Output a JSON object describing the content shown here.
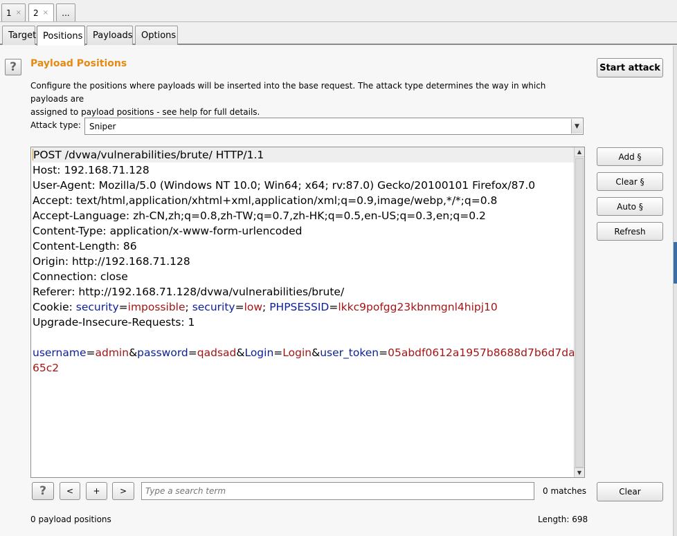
{
  "top_tabs": [
    {
      "label": "1",
      "close": "×"
    },
    {
      "label": "2",
      "close": "×"
    },
    {
      "label": "..."
    }
  ],
  "sub_tabs": [
    "Target",
    "Positions",
    "Payloads",
    "Options"
  ],
  "active_sub_tab": "Positions",
  "help_glyph": "?",
  "section": {
    "title": "Payload Positions",
    "description_1": "Configure the positions where payloads will be inserted into the base request. The attack type determines the way in which payloads are",
    "description_2": "assigned to payload positions - see help for full details."
  },
  "start_attack_label": "Start attack",
  "attack_type": {
    "label": "Attack type:",
    "value": "Sniper"
  },
  "side_buttons": {
    "add": "Add §",
    "clear": "Clear §",
    "auto": "Auto §",
    "refresh": "Refresh"
  },
  "request": {
    "line1": "POST /dvwa/vulnerabilities/brute/ HTTP/1.1",
    "line2": "Host: 192.168.71.128",
    "line3": "User-Agent: Mozilla/5.0 (Windows NT 10.0; Win64; x64; rv:87.0) Gecko/20100101 Firefox/87.0",
    "line4": "Accept: text/html,application/xhtml+xml,application/xml;q=0.9,image/webp,*/*;q=0.8",
    "line5": "Accept-Language: zh-CN,zh;q=0.8,zh-TW;q=0.7,zh-HK;q=0.5,en-US;q=0.3,en;q=0.2",
    "line6": "Content-Type: application/x-www-form-urlencoded",
    "line7": "Content-Length: 86",
    "line8": "Origin: http://192.168.71.128",
    "line9": "Connection: close",
    "line10": "Referer: http://192.168.71.128/dvwa/vulnerabilities/brute/",
    "cookie": {
      "prefix": "Cookie: ",
      "k1": "security",
      "eq1": "=",
      "v1": "impossible",
      "sep1": "; ",
      "k2": "security",
      "eq2": "=",
      "v2": "low",
      "sep2": "; ",
      "k3": "PHPSESSID",
      "eq3": "=",
      "v3": "lkkc9pofgg23kbnmgnl4hipj10"
    },
    "line12": "Upgrade-Insecure-Requests: 1",
    "body": {
      "k1": "username",
      "eq1": "=",
      "v1": "admin",
      "amp1": "&",
      "k2": "password",
      "eq2": "=",
      "v2": "qadsad",
      "amp2": "&",
      "k3": "Login",
      "eq3": "=",
      "v3": "Login",
      "amp3": "&",
      "k4": "user_token",
      "eq4": "=",
      "v4a": "05abdf0612a1957b8688d7b6d7da",
      "v4b": "65c2"
    }
  },
  "search_bar": {
    "help": "?",
    "prev": "<",
    "add": "+",
    "next": ">",
    "placeholder": "Type a search term",
    "matches": "0 matches",
    "clear": "Clear"
  },
  "status": {
    "positions": "0 payload positions",
    "length": "Length: 698"
  }
}
